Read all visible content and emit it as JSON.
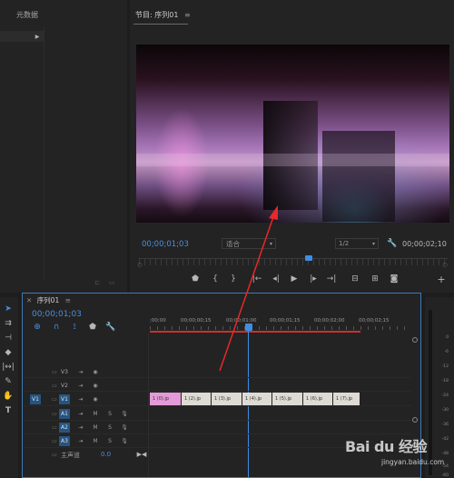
{
  "metadata_panel": {
    "title": "元数据"
  },
  "program_monitor": {
    "title": "节目: 序列01",
    "menu_icon": "≡",
    "current_timecode": "00;00;01;03",
    "fit": "适合",
    "resolution": "1/2",
    "duration": "00;00;02;10",
    "playhead_fraction": 0.55,
    "colors": {
      "timecode": "#4a8fe0",
      "background": "#232323"
    }
  },
  "timeline": {
    "tab_title": "序列01",
    "menu_icon": "≡",
    "timecode": "00;00;01;03",
    "ruler_labels": [
      ";00;00",
      "00;00;00;15",
      "00;00;01;00",
      "00;00;01;15",
      "00;00;02;00",
      "00;00;02;15"
    ],
    "video_tracks": [
      "V3",
      "V2",
      "V1"
    ],
    "audio_tracks": [
      "A1",
      "A2",
      "A3"
    ],
    "source_patch_video": "V1",
    "audio_buttons": {
      "mute": "M",
      "solo": "S"
    },
    "master_label": "主声道",
    "master_value": "0.0",
    "clips": [
      {
        "label": "1 (0).jp",
        "color": "#e49ad8"
      },
      {
        "label": "1 (2).jp",
        "color": "#dedbd4"
      },
      {
        "label": "1 (3).jp",
        "color": "#dedbd4"
      },
      {
        "label": "1 (4).jp",
        "color": "#dedbd4"
      },
      {
        "label": "1 (5).jp",
        "color": "#dedbd4"
      },
      {
        "label": "1 (6).jp",
        "color": "#dedbd4"
      },
      {
        "label": "1 (7).jp",
        "color": "#dedbd4"
      }
    ]
  },
  "audio_meter": {
    "labels": [
      "0",
      "-6",
      "-12",
      "-18",
      "-24",
      "-30",
      "-36",
      "-42",
      "-48",
      "-54",
      "-60"
    ]
  },
  "watermark": {
    "text": "Bai du 经验",
    "url": "jingyan.baidu.com"
  }
}
